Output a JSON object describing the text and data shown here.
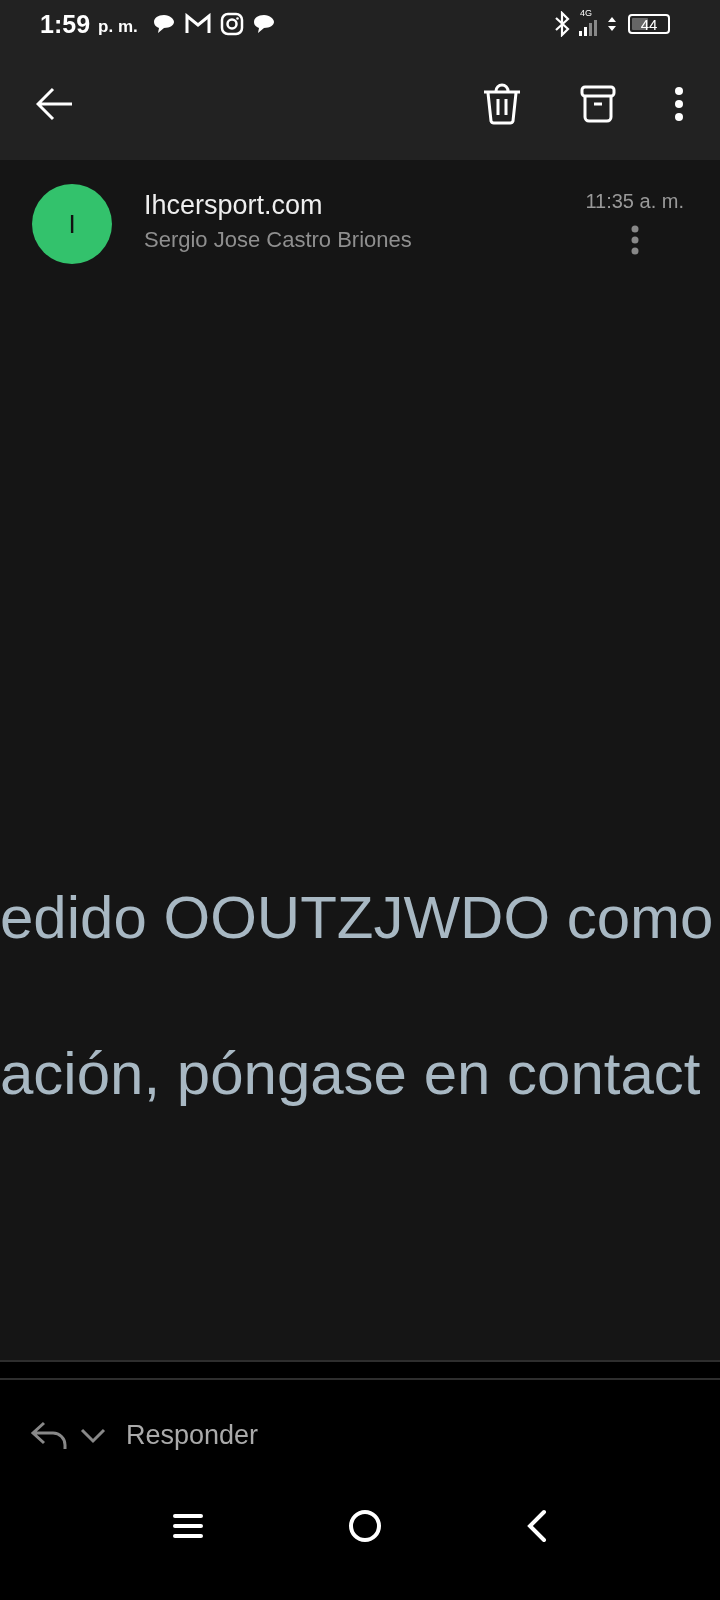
{
  "status_bar": {
    "time": "1:59",
    "period": "p. m.",
    "notifications": [
      {
        "kind": "chat"
      },
      {
        "kind": "mail"
      },
      {
        "kind": "camera"
      },
      {
        "kind": "chat"
      }
    ],
    "network": "4G",
    "battery": {
      "text": "44"
    }
  },
  "message": {
    "avatar_initial": "I",
    "sender": "Ihcersport.com",
    "recipient": "Sergio Jose Castro Briones",
    "time": "11:35 a. m.",
    "body_lines": [
      "edido OOUTZJWDO como",
      "ación, póngase en contact"
    ]
  },
  "reply": {
    "label": "Responder"
  }
}
